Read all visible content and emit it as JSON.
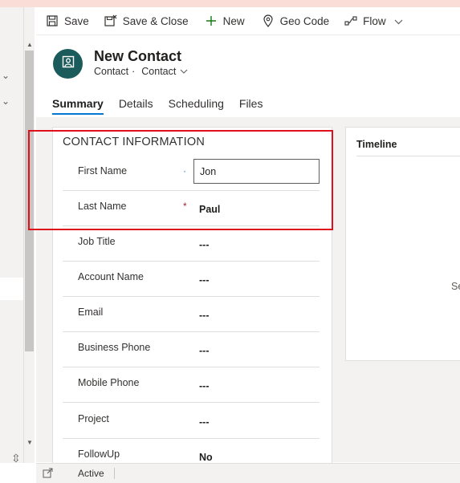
{
  "toolbar": {
    "save": "Save",
    "save_close": "Save & Close",
    "new": "New",
    "geo_code": "Geo Code",
    "flow": "Flow"
  },
  "header": {
    "title": "New Contact",
    "entity": "Contact",
    "form_name": "Contact"
  },
  "tabs": [
    "Summary",
    "Details",
    "Scheduling",
    "Files"
  ],
  "section": {
    "title": "CONTACT INFORMATION",
    "fields": [
      {
        "label": "First Name",
        "value": "Jon",
        "required": "recommended"
      },
      {
        "label": "Last Name",
        "value": "Paul",
        "required": "required"
      },
      {
        "label": "Job Title",
        "value": "---"
      },
      {
        "label": "Account Name",
        "value": "---"
      },
      {
        "label": "Email",
        "value": "---"
      },
      {
        "label": "Business Phone",
        "value": "---"
      },
      {
        "label": "Mobile Phone",
        "value": "---"
      },
      {
        "label": "Project",
        "value": "---"
      },
      {
        "label": "FollowUp",
        "value": "No"
      }
    ]
  },
  "timeline": {
    "title": "Timeline",
    "partial_text": "Se"
  },
  "status": {
    "text": "Active"
  },
  "colors": {
    "accent": "#0078d4",
    "avatar_bg": "#1b5b5b",
    "highlight": "#e0101a",
    "required": "#a4262c",
    "recommended": "#0078d4"
  }
}
